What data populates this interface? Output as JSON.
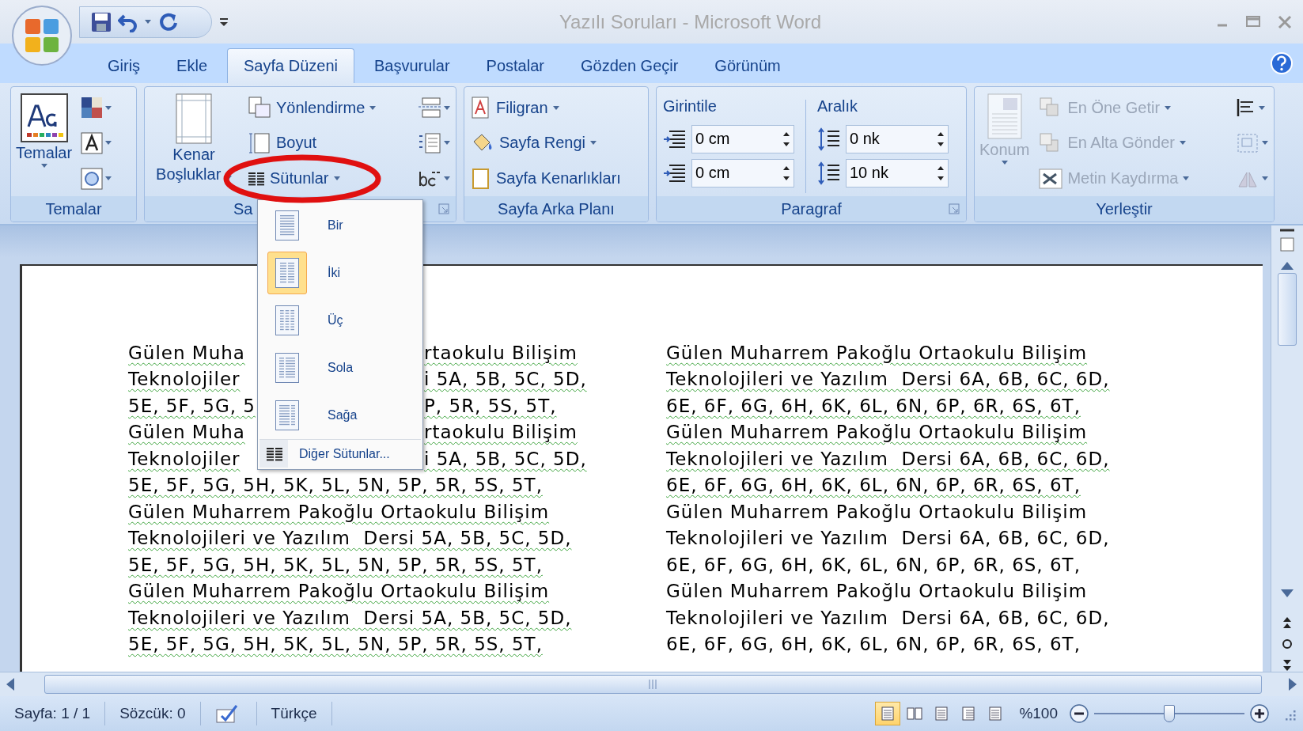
{
  "window": {
    "title": "Yazılı Soruları - Microsoft Word"
  },
  "tabs": [
    {
      "label": "Giriş",
      "selected": false
    },
    {
      "label": "Ekle",
      "selected": false
    },
    {
      "label": "Sayfa Düzeni",
      "selected": true
    },
    {
      "label": "Başvurular",
      "selected": false
    },
    {
      "label": "Postalar",
      "selected": false
    },
    {
      "label": "Gözden Geçir",
      "selected": false
    },
    {
      "label": "Görünüm",
      "selected": false
    }
  ],
  "ribbon": {
    "themes": {
      "button": "Temalar",
      "group_label": "Temalar"
    },
    "page_setup": {
      "margins": [
        "Kenar",
        "Boşluklar"
      ],
      "buttons": [
        "Yönlendirme",
        "Boyut",
        "Sütunlar"
      ],
      "group_label": "Sa"
    },
    "page_background": {
      "buttons": [
        "Filigran",
        "Sayfa Rengi",
        "Sayfa Kenarlıkları"
      ],
      "group_label": "Sayfa Arka Planı"
    },
    "paragraph": {
      "indent_label": "Girintile",
      "spacing_label": "Aralık",
      "indent": [
        "0 cm",
        "0 cm"
      ],
      "spacing": [
        "0 nk",
        "10 nk"
      ],
      "group_label": "Paragraf"
    },
    "arrange": {
      "position": {
        "label": "Konum",
        "disabled": true
      },
      "buttons": [
        {
          "label": "En Öne Getir",
          "disabled": true
        },
        {
          "label": "En Alta Gönder",
          "disabled": true
        },
        {
          "label": "Metin Kaydırma",
          "disabled": true
        }
      ],
      "group_label": "Yerleştir"
    }
  },
  "columns_menu": {
    "items": [
      {
        "label": "Bir",
        "selected": false
      },
      {
        "label": "İki",
        "selected": true
      },
      {
        "label": "Üç",
        "selected": false
      },
      {
        "label": "Sola",
        "selected": false
      },
      {
        "label": "Sağa",
        "selected": false
      }
    ],
    "more": "Diğer Sütunlar..."
  },
  "document": {
    "left_column": [
      {
        "parts": [
          "Gülen Muha",
          "rtaokulu Bilişim"
        ],
        "flagged": true
      },
      {
        "parts": [
          "Teknolojiler",
          "i 5A, 5B, 5C, 5D,"
        ],
        "flagged": true
      },
      {
        "parts": [
          "5E, 5F, 5G, 5",
          "P, 5R, 5S, 5T,"
        ],
        "flagged": true
      },
      {
        "parts": [
          "Gülen Muha",
          "rtaokulu Bilişim"
        ],
        "flagged": true
      },
      {
        "parts": [
          "Teknolojiler",
          "i 5A, 5B, 5C, 5D,"
        ],
        "flagged": true
      },
      {
        "parts": [
          "5E, 5F, 5G, 5H, 5K, 5L, 5N, 5P, 5R, 5S, 5T,"
        ],
        "flagged": true
      },
      {
        "parts": [
          "Gülen Muharrem Pakoğlu Ortaokulu Bilişim"
        ],
        "flagged": true
      },
      {
        "parts": [
          "Teknolojileri ve Yazılım  Dersi 5A, 5B, 5C, 5D,"
        ],
        "flagged": true
      },
      {
        "parts": [
          "5E, 5F, 5G, 5H, 5K, 5L, 5N, 5P, 5R, 5S, 5T,"
        ],
        "flagged": true
      },
      {
        "parts": [
          "Gülen Muharrem Pakoğlu Ortaokulu Bilişim"
        ],
        "flagged": true
      },
      {
        "parts": [
          "Teknolojileri ve Yazılım  Dersi 5A, 5B, 5C, 5D,"
        ],
        "flagged": true
      },
      {
        "parts": [
          "5E, 5F, 5G, 5H, 5K, 5L, 5N, 5P, 5R, 5S, 5T,"
        ],
        "flagged": true
      }
    ],
    "right_column": [
      {
        "text": "Gülen Muharrem Pakoğlu Ortaokulu Bilişim",
        "flagged": true
      },
      {
        "text": "Teknolojileri ve Yazılım  Dersi 6A, 6B, 6C, 6D,",
        "flagged": true
      },
      {
        "text": "6E, 6F, 6G, 6H, 6K, 6L, 6N, 6P, 6R, 6S, 6T,",
        "flagged": true
      },
      {
        "text": "Gülen Muharrem Pakoğlu Ortaokulu Bilişim",
        "flagged": true
      },
      {
        "text": "Teknolojileri ve Yazılım  Dersi 6A, 6B, 6C, 6D,",
        "flagged": true
      },
      {
        "text": "6E, 6F, 6G, 6H, 6K, 6L, 6N, 6P, 6R, 6S, 6T,",
        "flagged": true
      },
      {
        "text": "Gülen Muharrem Pakoğlu Ortaokulu Bilişim",
        "flagged": false
      },
      {
        "text": "Teknolojileri ve Yazılım  Dersi 6A, 6B, 6C, 6D,",
        "flagged": false
      },
      {
        "text": "6E, 6F, 6G, 6H, 6K, 6L, 6N, 6P, 6R, 6S, 6T,",
        "flagged": false
      },
      {
        "text": "Gülen Muharrem Pakoğlu Ortaokulu Bilişim",
        "flagged": false
      },
      {
        "text": "Teknolojileri ve Yazılım  Dersi 6A, 6B, 6C, 6D,",
        "flagged": false
      },
      {
        "text": "6E, 6F, 6G, 6H, 6K, 6L, 6N, 6P, 6R, 6S, 6T,",
        "flagged": false
      }
    ]
  },
  "status_bar": {
    "page": "Sayfa: 1 / 1",
    "words": "Sözcük: 0",
    "language": "Türkçe",
    "views": [
      {
        "selected": true
      },
      {
        "selected": false
      },
      {
        "selected": false
      },
      {
        "selected": false
      },
      {
        "selected": false
      }
    ],
    "zoom": "%100",
    "zoom_slider": {
      "level": 0.5
    }
  }
}
